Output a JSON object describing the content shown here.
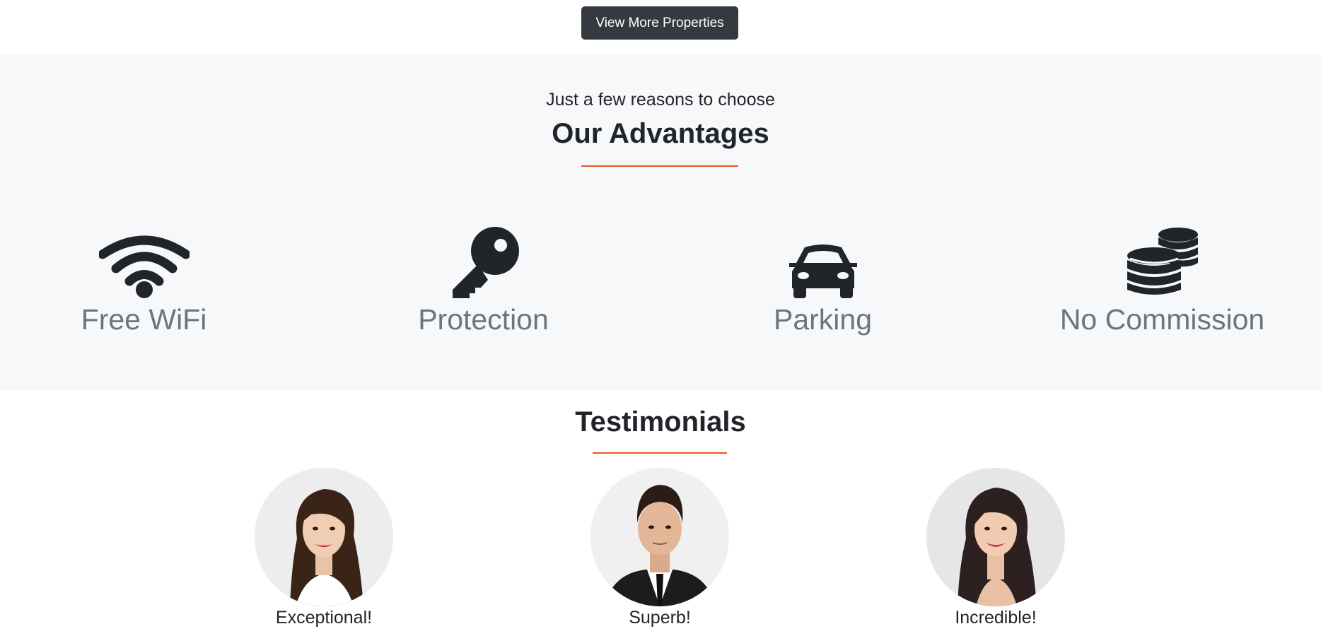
{
  "top": {
    "view_more_label": "View More Properties"
  },
  "advantages": {
    "subtitle": "Just a few reasons to choose",
    "title": "Our Advantages",
    "accent_color": "#e8541e",
    "features": [
      {
        "label": "Free WiFi",
        "icon": "wifi-icon"
      },
      {
        "label": "Protection",
        "icon": "key-icon"
      },
      {
        "label": "Parking",
        "icon": "car-icon"
      },
      {
        "label": "No Commission",
        "icon": "coins-icon"
      }
    ]
  },
  "testimonials": {
    "title": "Testimonials",
    "items": [
      {
        "caption": "Exceptional!",
        "avatar": "woman-avatar"
      },
      {
        "caption": "Superb!",
        "avatar": "man-avatar"
      },
      {
        "caption": "Incredible!",
        "avatar": "woman-avatar"
      }
    ]
  }
}
